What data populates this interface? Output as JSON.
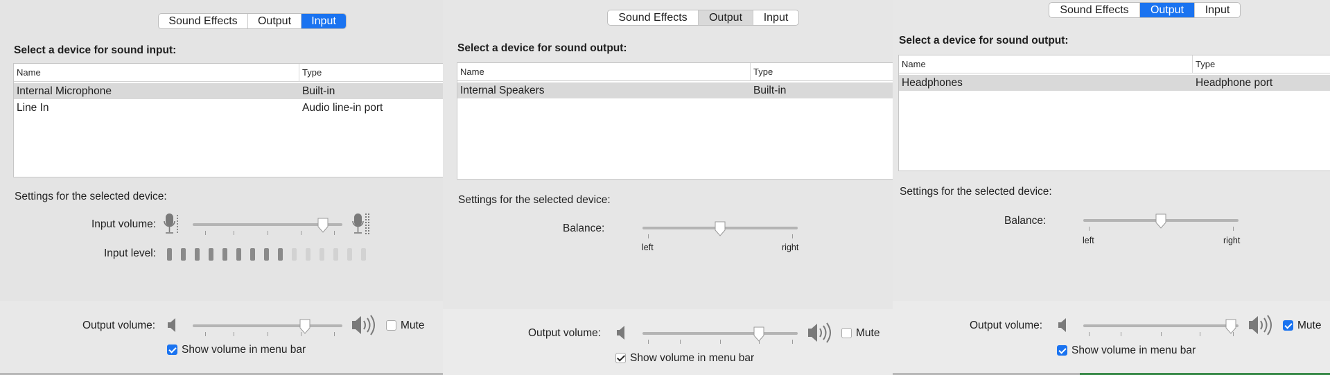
{
  "tabs": {
    "sound_effects": "Sound Effects",
    "output": "Output",
    "input": "Input"
  },
  "columns": {
    "name": "Name",
    "type": "Type"
  },
  "panels": [
    {
      "selected_tab": "Input",
      "heading": "Select a device for sound input:",
      "devices": [
        {
          "name": "Internal Microphone",
          "type": "Built-in",
          "selected": true
        },
        {
          "name": "Line In",
          "type": "Audio line-in port",
          "selected": false
        }
      ],
      "settings_label": "Settings for the selected device:",
      "input_volume_label": "Input volume:",
      "input_volume": 0.87,
      "input_level_label": "Input level:",
      "input_level_segments": 15,
      "input_level_active": 9,
      "output_volume_label": "Output volume:",
      "output_volume": 0.75,
      "mute_label": "Mute",
      "mute": false,
      "menu_bar_label": "Show volume in menu bar",
      "menu_bar": true
    },
    {
      "selected_tab": "Output",
      "heading": "Select a device for sound output:",
      "devices": [
        {
          "name": "Internal Speakers",
          "type": "Built-in",
          "selected": true
        }
      ],
      "settings_label": "Settings for the selected device:",
      "balance_label": "Balance:",
      "balance": 0.5,
      "balance_left": "left",
      "balance_right": "right",
      "output_volume_label": "Output volume:",
      "output_volume": 0.75,
      "mute_label": "Mute",
      "mute": false,
      "menu_bar_label": "Show volume in menu bar",
      "menu_bar": true
    },
    {
      "selected_tab": "Output",
      "heading": "Select a device for sound output:",
      "devices": [
        {
          "name": "Headphones",
          "type": "Headphone port",
          "selected": true
        }
      ],
      "settings_label": "Settings for the selected device:",
      "balance_label": "Balance:",
      "balance": 0.5,
      "balance_left": "left",
      "balance_right": "right",
      "output_volume_label": "Output volume:",
      "output_volume": 0.95,
      "mute_label": "Mute",
      "mute": true,
      "menu_bar_label": "Show volume in menu bar",
      "menu_bar": true
    }
  ],
  "colors": {
    "accent": "#1a73f0",
    "selected_row": "#d9d9d9",
    "level_on": "#8a8a8a",
    "level_off": "#d2d2d2"
  },
  "icons": [
    "speaker-low-icon",
    "speaker-high-icon",
    "microphone-icon",
    "knob-icon",
    "checkmark-icon"
  ]
}
